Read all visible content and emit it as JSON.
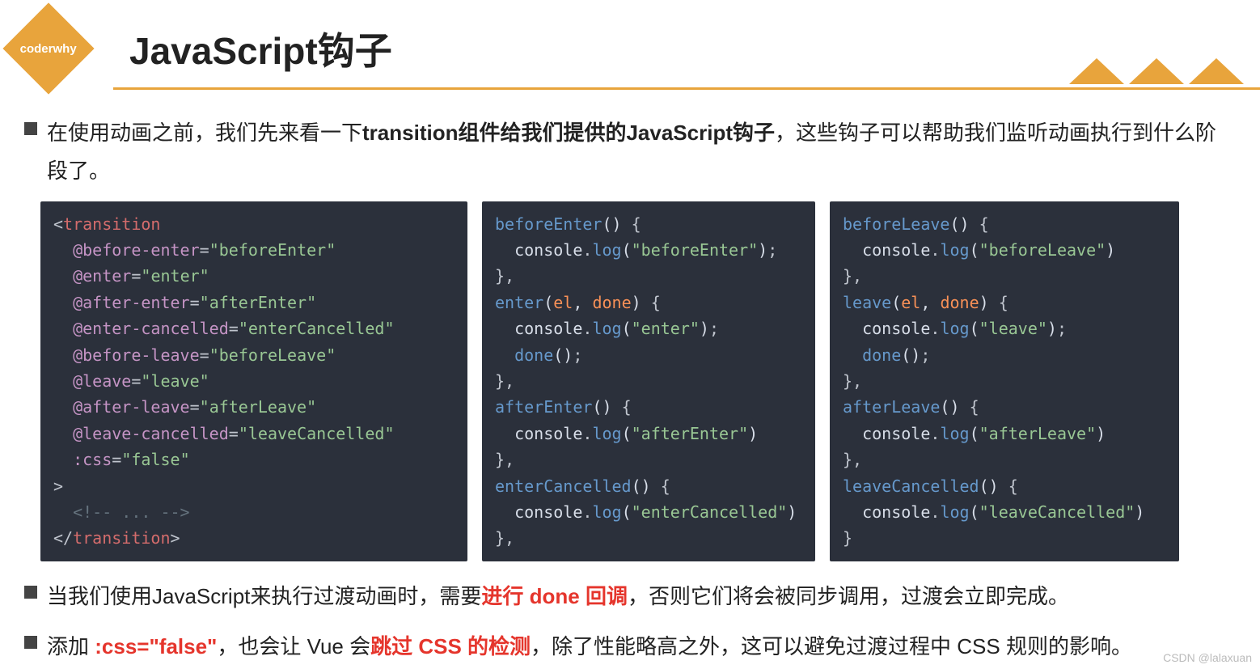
{
  "header": {
    "logo_text": "coderwhy",
    "title": "JavaScript钩子"
  },
  "bullets": {
    "b1_pre": "在使用动画之前，我们先来看一下",
    "b1_bold": "transition组件给我们提供的JavaScript钩子",
    "b1_post": "，这些钩子可以帮助我们监听动画执行到什么阶段了。",
    "b2_pre": "当我们使用JavaScript来执行过渡动画时，需要",
    "b2_red": "进行 done 回调",
    "b2_post": "，否则它们将会被同步调用，过渡会立即完成。",
    "b3_pre": "添加 ",
    "b3_red1": ":css=\"false\"",
    "b3_mid": "，也会让 Vue 会",
    "b3_red2": "跳过 CSS 的检测",
    "b3_post": "，除了性能略高之外，这可以避免过渡过程中 CSS 规则的影响。"
  },
  "code1": {
    "open_tag": "transition",
    "attrs": {
      "a1_name": "before-enter",
      "a1_val": "beforeEnter",
      "a2_name": "enter",
      "a2_val": "enter",
      "a3_name": "after-enter",
      "a3_val": "afterEnter",
      "a4_name": "enter-cancelled",
      "a4_val": "enterCancelled",
      "a5_name": "before-leave",
      "a5_val": "beforeLeave",
      "a6_name": "leave",
      "a6_val": "leave",
      "a7_name": "after-leave",
      "a7_val": "afterLeave",
      "a8_name": "leave-cancelled",
      "a8_val": "leaveCancelled",
      "css_name": "css",
      "css_val": "false"
    },
    "comment": "<!-- ... -->",
    "close_tag": "transition"
  },
  "code2": {
    "f1": "beforeEnter",
    "f1_log": "beforeEnter",
    "f2": "enter",
    "f2_p1": "el",
    "f2_p2": "done",
    "f2_log": "enter",
    "f2_call": "done",
    "f3": "afterEnter",
    "f3_log": "afterEnter",
    "f4": "enterCancelled",
    "f4_log": "enterCancelled",
    "console": "console",
    "log": "log"
  },
  "code3": {
    "f1": "beforeLeave",
    "f1_log": "beforeLeave",
    "f2": "leave",
    "f2_p1": "el",
    "f2_p2": "done",
    "f2_log": "leave",
    "f2_call": "done",
    "f3": "afterLeave",
    "f3_log": "afterLeave",
    "f4": "leaveCancelled",
    "f4_log": "leaveCancelled",
    "console": "console",
    "log": "log"
  },
  "watermark": "CSDN @lalaxuan"
}
